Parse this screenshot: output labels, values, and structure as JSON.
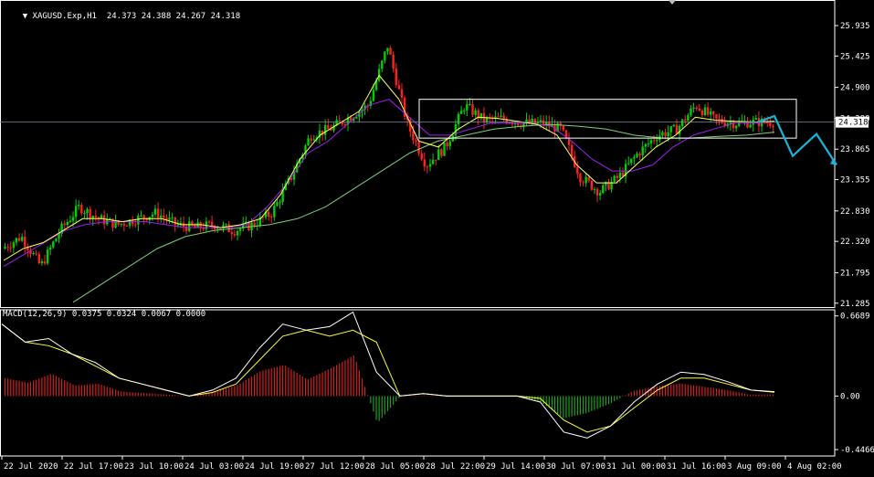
{
  "chart_data": [
    {
      "type": "candlestick",
      "symbol_label": "XAGUSD.Exp,H1",
      "ohlc_label": "24.373 24.388 24.267 24.318",
      "price_ticks": [
        "25.935",
        "25.425",
        "24.900",
        "24.380",
        "23.865",
        "23.355",
        "22.830",
        "22.320",
        "21.795",
        "21.285"
      ],
      "price_tick_values": [
        25.935,
        25.425,
        24.9,
        24.38,
        23.865,
        23.355,
        22.83,
        22.32,
        21.795,
        21.285
      ],
      "ylim": [
        21.22,
        26.18
      ],
      "current_price_label": "24.318",
      "current_price": 24.318,
      "time_ticks": [
        "22 Jul 2020",
        "22 Jul 17:00",
        "23 Jul 10:00",
        "24 Jul 03:00",
        "24 Jul 19:00",
        "27 Jul 12:00",
        "28 Jul 05:00",
        "28 Jul 22:00",
        "29 Jul 14:00",
        "30 Jul 07:00",
        "31 Jul 00:00",
        "31 Jul 16:00",
        "3 Aug 09:00",
        "4 Aug 02:00"
      ],
      "close_path": [
        22.2,
        22.4,
        21.9,
        22.5,
        22.9,
        22.7,
        22.6,
        22.7,
        22.8,
        22.6,
        22.55,
        22.6,
        22.5,
        22.6,
        22.8,
        23.4,
        24.1,
        24.2,
        24.4,
        24.6,
        25.6,
        24.3,
        23.6,
        23.9,
        24.6,
        24.35,
        24.38,
        24.3,
        24.3,
        24.2,
        23.4,
        23.15,
        23.4,
        23.8,
        24.1,
        24.2,
        24.6,
        24.35,
        24.3,
        24.32,
        24.318
      ],
      "ma_fast_path": [
        22.0,
        22.2,
        22.3,
        22.5,
        22.7,
        22.7,
        22.65,
        22.7,
        22.7,
        22.6,
        22.6,
        22.55,
        22.6,
        22.7,
        23.1,
        23.7,
        24.1,
        24.3,
        24.5,
        25.1,
        24.7,
        24.0,
        23.9,
        24.2,
        24.4,
        24.38,
        24.33,
        24.28,
        24.1,
        23.6,
        23.3,
        23.3,
        23.6,
        23.9,
        24.1,
        24.4,
        24.35,
        24.33,
        24.32,
        24.33
      ],
      "ma_mid_path": [
        21.9,
        22.1,
        22.3,
        22.5,
        22.6,
        22.65,
        22.65,
        22.65,
        22.6,
        22.55,
        22.55,
        22.55,
        22.6,
        22.9,
        23.3,
        23.8,
        24.0,
        24.3,
        24.6,
        24.7,
        24.4,
        24.1,
        24.1,
        24.2,
        24.3,
        24.3,
        24.3,
        24.25,
        24.0,
        23.7,
        23.5,
        23.5,
        23.6,
        23.9,
        24.1,
        24.2,
        24.3,
        24.3,
        24.32
      ],
      "ma_slow_path": [
        21.3,
        21.6,
        21.9,
        22.2,
        22.4,
        22.5,
        22.55,
        22.6,
        22.7,
        22.9,
        23.2,
        23.5,
        23.8,
        24.0,
        24.1,
        24.2,
        24.25,
        24.28,
        24.25,
        24.2,
        24.1,
        24.05,
        24.05,
        24.08,
        24.1,
        24.15
      ],
      "box": {
        "price_top": 24.7,
        "price_bottom": 24.05,
        "time_start_tick": 7,
        "time_end_tick": 13
      },
      "forecast_prices": [
        24.32,
        24.42,
        23.75,
        24.12,
        23.6
      ],
      "colors": {
        "up": "#00d000",
        "down": "#ff2020",
        "fast_ma": "#ffff66",
        "mid_ma": "#a020f0",
        "slow_ma": "#7ccf7c",
        "forecast": "#19b4d8",
        "box": "#ffffff",
        "grid_text": "#ffffff"
      }
    },
    {
      "type": "macd",
      "label": "MACD(12,26,9) 0.0375 0.0324 0.0067 0.0000",
      "ticks": [
        "0.6689",
        "0.00",
        "-0.4466"
      ],
      "tick_values": [
        0.6689,
        0.0,
        -0.4466
      ],
      "ylim": [
        -0.5,
        0.72
      ],
      "macd_path": [
        0.6,
        0.45,
        0.48,
        0.35,
        0.28,
        0.15,
        0.1,
        0.05,
        0.0,
        0.05,
        0.15,
        0.4,
        0.6,
        0.55,
        0.58,
        0.7,
        0.2,
        0.0,
        0.02,
        0.0,
        0.0,
        0.0,
        0.0,
        -0.05,
        -0.3,
        -0.35,
        -0.25,
        -0.05,
        0.1,
        0.2,
        0.18,
        0.12,
        0.05,
        0.037
      ],
      "signal_path": [
        0.6,
        0.45,
        0.42,
        0.35,
        0.25,
        0.15,
        0.1,
        0.05,
        0.0,
        0.03,
        0.1,
        0.3,
        0.5,
        0.55,
        0.5,
        0.55,
        0.45,
        0.0,
        0.02,
        0.0,
        0.0,
        0.0,
        0.0,
        -0.02,
        -0.2,
        -0.3,
        -0.25,
        -0.1,
        0.05,
        0.15,
        0.15,
        0.1,
        0.05,
        0.032
      ],
      "colors": {
        "macd": "#ffffff",
        "signal": "#ffff33",
        "hist_pos": "#d02020",
        "hist_neg": "#20a020"
      }
    }
  ]
}
